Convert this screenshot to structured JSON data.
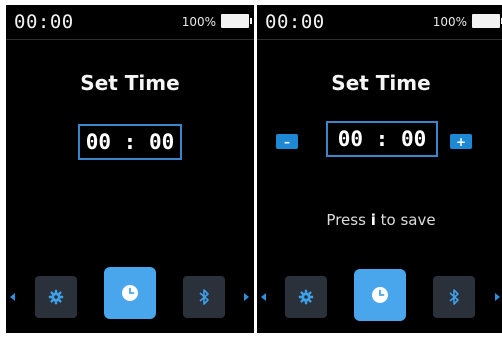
{
  "screens": [
    {
      "status": {
        "time": "00:00",
        "battery": "100%"
      },
      "title": "Set Time",
      "time_value": "00 : 00"
    },
    {
      "status": {
        "time": "00:00",
        "battery": "100%"
      },
      "title": "Set Time",
      "time_value": "00 : 00",
      "decrement_label": "–",
      "increment_label": "+",
      "hint": {
        "before": "Press",
        "key": "i",
        "after": "to save"
      }
    }
  ],
  "nav_icons": [
    "settings-gear-icon",
    "clock-icon",
    "bluetooth-icon"
  ],
  "colors": {
    "accent": "#3a86c8",
    "active_tab": "#4aa6ec",
    "button": "#1e88d4",
    "background": "#000000"
  }
}
